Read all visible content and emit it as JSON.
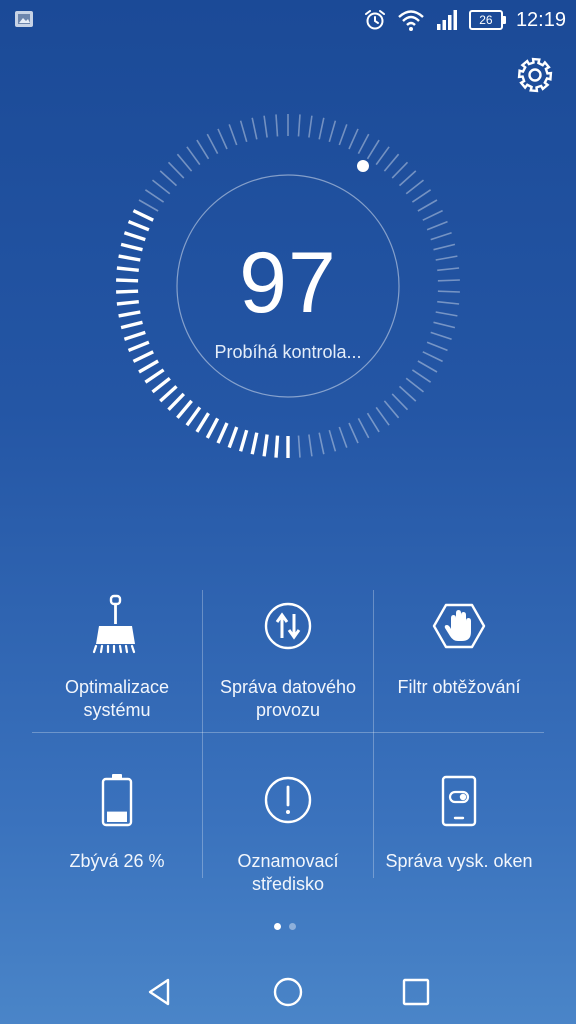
{
  "status_bar": {
    "battery_level": "26",
    "time": "12:19",
    "icons": [
      "image-notification-icon",
      "alarm-icon",
      "wifi-icon",
      "signal-icon",
      "battery-icon"
    ]
  },
  "header": {
    "settings_icon": "gear-icon"
  },
  "scan": {
    "score": "97",
    "status": "Probíhá kontrola...",
    "progress": 0.5
  },
  "tools": [
    {
      "label": "Optimalizace systému",
      "line1": "Optimalizace",
      "line2": "systému",
      "icon": "broom-icon"
    },
    {
      "label": "Správa datového provozu",
      "line1": "Správa datového",
      "line2": "provozu",
      "icon": "data-traffic-icon"
    },
    {
      "label": "Filtr obtěžování",
      "line1": "Filtr obtěžování",
      "line2": "",
      "icon": "hand-stop-icon"
    },
    {
      "label": "Zbývá 26 %",
      "line1": "Zbývá 26 %",
      "line2": "",
      "icon": "battery-icon"
    },
    {
      "label": "Oznamovací středisko",
      "line1": "Oznamovací",
      "line2": "středisko",
      "icon": "exclamation-icon"
    },
    {
      "label": "Správa vysk. oken",
      "line1": "Správa vysk. oken",
      "line2": "",
      "icon": "floating-window-icon"
    }
  ],
  "pager": {
    "pages": 2,
    "current": 1
  },
  "nav": {
    "icons": [
      "back-icon",
      "home-icon",
      "recents-icon"
    ]
  },
  "colors": {
    "background_top": "#1b4a97",
    "background_bottom": "#4a85c8",
    "accent": "#ffffff"
  }
}
